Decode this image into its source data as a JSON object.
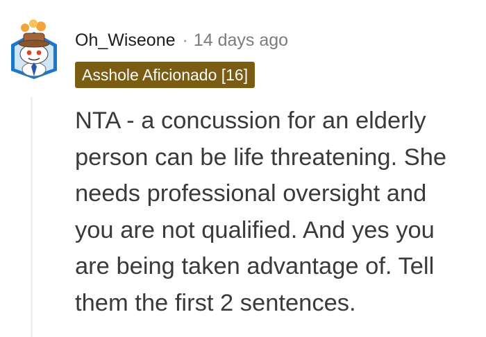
{
  "comment": {
    "username": "Oh_Wiseone",
    "separator": "·",
    "timestamp": "14 days ago",
    "flair": "Asshole Aficionado [16]",
    "body_lines": [
      "NTA - a concussion for an elderly",
      "person can be life threatening. She",
      "needs professional oversight and",
      "you are not qualified. And yes you",
      "are being taken advantage of. Tell",
      "them the first 2 sentences."
    ],
    "avatar_icon": "snoo-chef-avatar",
    "colors": {
      "flair_bg": "#7a5c12",
      "flair_text": "#ffffff",
      "username": "#1c1c1c",
      "meta": "#7c7c7c",
      "body": "#3a3a3a",
      "thread_line": "#edeff1"
    }
  }
}
